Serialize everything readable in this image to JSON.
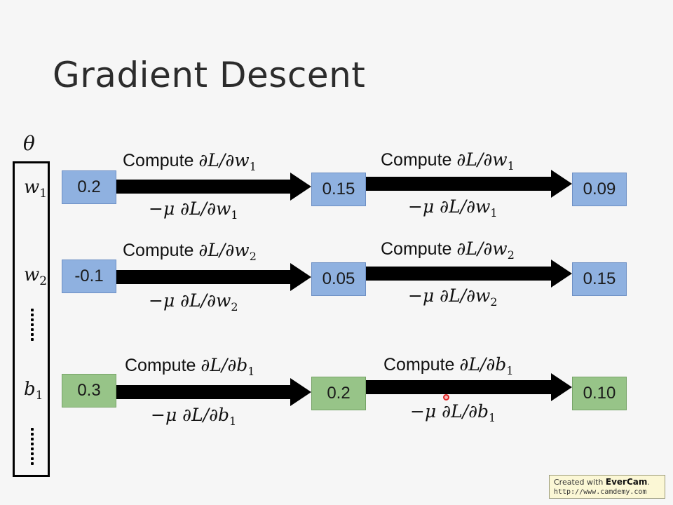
{
  "slide": {
    "title": "Gradient Descent"
  },
  "theta": {
    "symbol": "θ"
  },
  "params": [
    {
      "name": "w",
      "sub": "1"
    },
    {
      "name": "w",
      "sub": "2"
    },
    {
      "name": "b",
      "sub": "1"
    }
  ],
  "rows": [
    {
      "values": [
        "0.2",
        "0.15",
        "0.09"
      ],
      "color": "#8fb1e0",
      "steps": [
        {
          "compute": "Compute",
          "deriv": "∂L/∂w",
          "sub": "1",
          "update_prefix": "−μ ∂L/∂w",
          "update_sub": "1"
        },
        {
          "compute": "Compute",
          "deriv": "∂L/∂w",
          "sub": "1",
          "update_prefix": "−μ ∂L/∂w",
          "update_sub": "1"
        }
      ]
    },
    {
      "values": [
        "-0.1",
        "0.05",
        "0.15"
      ],
      "color": "#8fb1e0",
      "steps": [
        {
          "compute": "Compute",
          "deriv": "∂L/∂w",
          "sub": "2",
          "update_prefix": "−μ ∂L/∂w",
          "update_sub": "2"
        },
        {
          "compute": "Compute",
          "deriv": "∂L/∂w",
          "sub": "2",
          "update_prefix": "−μ ∂L/∂w",
          "update_sub": "2"
        }
      ]
    },
    {
      "values": [
        "0.3",
        "0.2",
        "0.10"
      ],
      "color": "#97c488",
      "steps": [
        {
          "compute": "Compute",
          "deriv": "∂L/∂b",
          "sub": "1",
          "update_prefix": "−μ ∂L/∂b",
          "update_sub": "1"
        },
        {
          "compute": "Compute",
          "deriv": "∂L/∂b",
          "sub": "1",
          "update_prefix": "−μ ∂L/∂b",
          "update_sub": "1"
        }
      ]
    }
  ],
  "watermark": {
    "line1_prefix": "Created with ",
    "line1_brand": "EverCam",
    "line1_suffix": ".",
    "line2": "http://www.camdemy.com"
  }
}
